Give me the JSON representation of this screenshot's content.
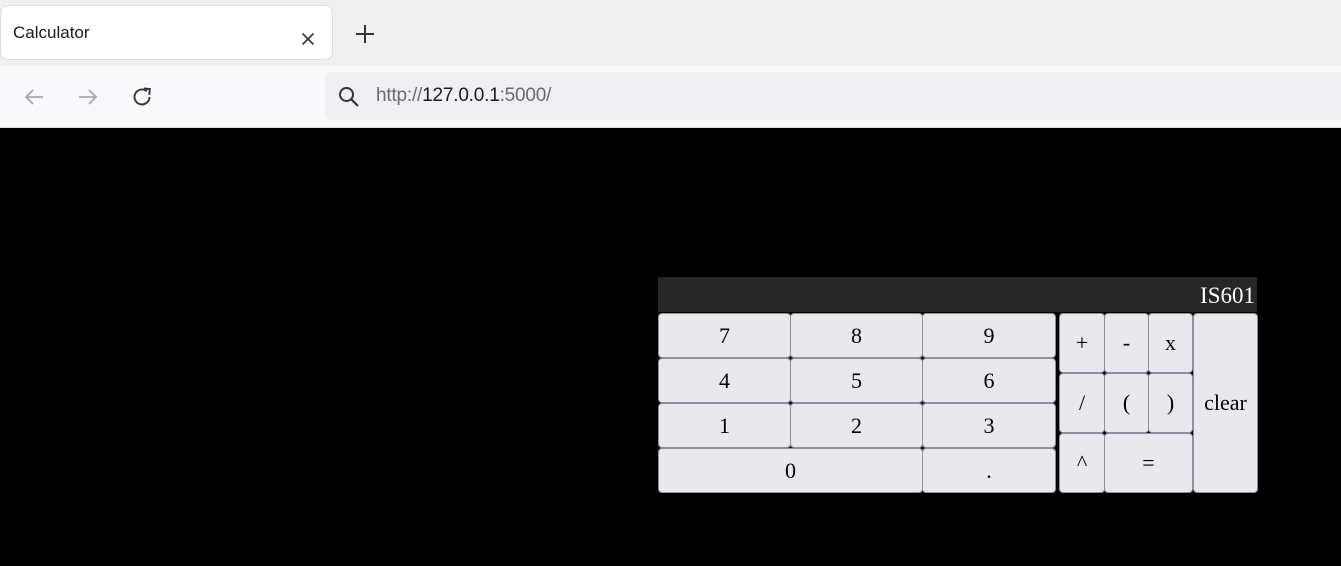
{
  "tab": {
    "title": "Calculator"
  },
  "url": {
    "scheme": "http://",
    "host": "127.0.0.1",
    "port": ":5000/"
  },
  "calculator": {
    "display": "IS601",
    "keys": {
      "k7": "7",
      "k8": "8",
      "k9": "9",
      "k4": "4",
      "k5": "5",
      "k6": "6",
      "k1": "1",
      "k2": "2",
      "k3": "3",
      "k0": "0",
      "dot": ".",
      "plus": "+",
      "minus": "-",
      "times": "x",
      "divide": "/",
      "lparen": "(",
      "rparen": ")",
      "power": "^",
      "equals": "=",
      "clear": "clear"
    }
  },
  "colors": {
    "page_background": "#000000",
    "display_background": "#262626",
    "key_background": "#e9e9ed",
    "key_border": "#8f8f9d"
  }
}
